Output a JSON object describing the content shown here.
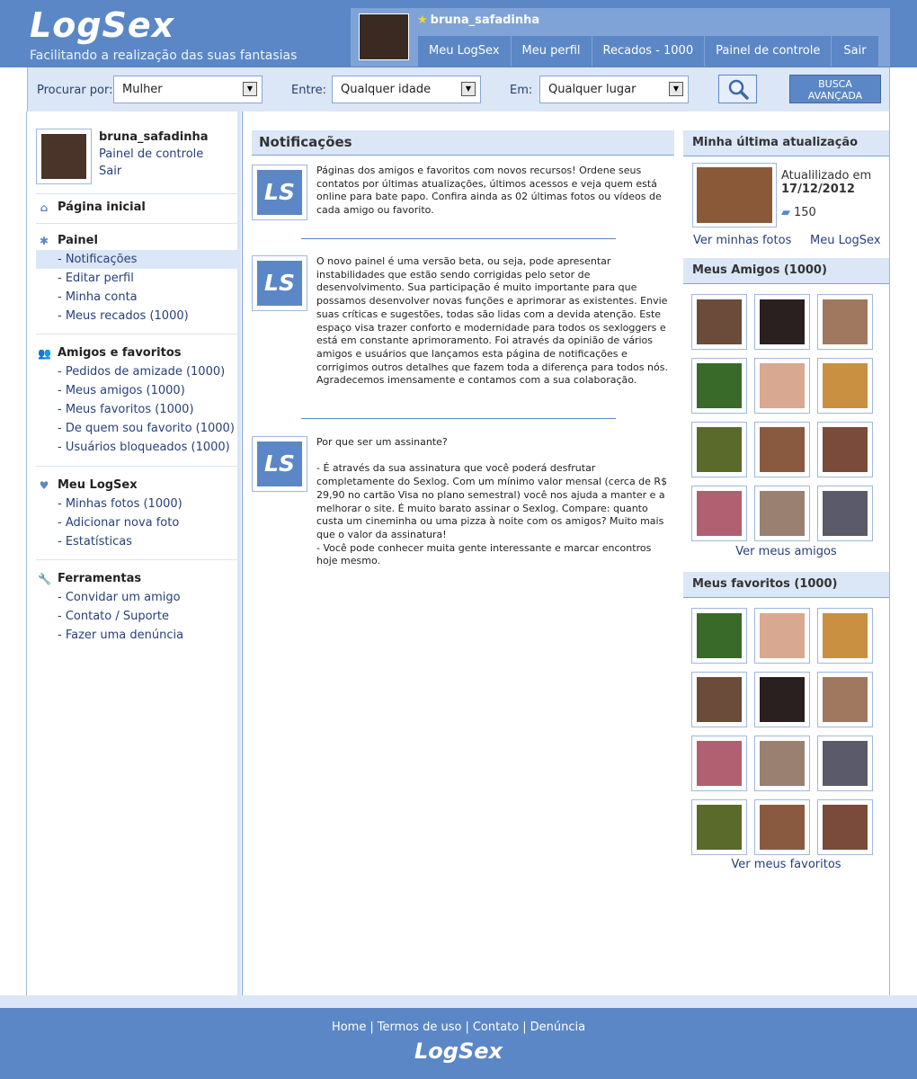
{
  "brand": {
    "logo": "LogSex",
    "tagline": "Facilitando a realização das suas fantasias"
  },
  "user": {
    "name": "bruna_safadinha"
  },
  "nav": [
    "Meu LogSex",
    "Meu perfil",
    "Recados - 1000",
    "Painel de controle",
    "Sair"
  ],
  "search": {
    "label_procurar": "Procurar por:",
    "procurar_value": "Mulher",
    "label_entre": "Entre:",
    "entre_value": "Qualquer idade",
    "label_em": "Em:",
    "em_value": "Qualquer lugar",
    "advanced_line1": "BUSCA",
    "advanced_line2": "AVANÇADA",
    "search_icon": "magnifier-icon"
  },
  "sidebar": {
    "me": {
      "name": "bruna_safadinha",
      "link1": "Painel de controle",
      "link2": "Sair"
    },
    "home": "Página inicial",
    "painel": {
      "title": "Painel",
      "items": [
        "- Notificações",
        "- Editar perfil",
        "- Minha conta",
        "- Meus recados (1000)"
      ]
    },
    "amigos": {
      "title": "Amigos e favoritos",
      "items": [
        "- Pedidos de amizade (1000)",
        "- Meus amigos (1000)",
        "- Meus favoritos (1000)",
        "- De quem sou favorito (1000)",
        "- Usuários bloqueados (1000)"
      ]
    },
    "meulogsex": {
      "title": "Meu LogSex",
      "items": [
        "- Minhas fotos (1000)",
        "- Adicionar nova foto",
        "- Estatísticas"
      ]
    },
    "ferramentas": {
      "title": "Ferramentas",
      "items": [
        "- Convidar um amigo",
        "- Contato / Suporte",
        "- Fazer uma denúncia"
      ]
    }
  },
  "main": {
    "title": "Notificações",
    "badge": "LS",
    "n1": "Páginas dos amigos e favoritos com novos recursos! Ordene seus contatos por últimas atualizações, últimos acessos e veja quem está online para bate papo. Confira ainda as 02 últimas fotos ou vídeos de cada amigo ou favorito.",
    "n2": "O novo painel é uma versão beta, ou seja, pode apresentar instabilidades que estão sendo corrigidas pelo setor de desenvolvimento. Sua participação é muito importante para que possamos desenvolver novas funções e aprimorar as existentes. Envie suas críticas e sugestões, todas são lidas com a devida atenção. Este espaço visa trazer conforto e modernidade para todos os sexloggers e está em constante aprimoramento. Foi através da opinião de vários amigos e usuários que lançamos esta página de notificações e corrigimos outros detalhes que fazem toda a diferença para todos nós. Agradecemos imensamente e contamos com a sua colaboração.",
    "n3_title": "Por que ser um assinante?",
    "n3_p1": "- É através da sua assinatura que você poderá desfrutar completamente do Sexlog. Com um mínimo valor mensal (cerca de R$ 29,90 no cartão Visa no plano semestral) você nos ajuda a manter e a melhorar o site. É muito barato assinar o Sexlog. Compare: quanto custa um cineminha ou uma pizza à noite com os amigos? Muito mais que o valor da assinatura!",
    "n3_p2": "- Você pode conhecer muita gente interessante e marcar encontros hoje mesmo."
  },
  "right": {
    "update": {
      "title": "Minha última atualização",
      "updated_label": "Atualilizado em",
      "date": "17/12/2012",
      "count": "150",
      "link_photos": "Ver minhas fotos",
      "link_meu": "Meu LogSex"
    },
    "friends": {
      "title": "Meus Amigos (1000)",
      "more": "Ver meus amigos"
    },
    "favorites": {
      "title": "Meus favoritos (1000)",
      "more": "Ver meus favoritos"
    },
    "friend_colors": [
      "#6b4b3a",
      "#2a2020",
      "#a07860",
      "#3a6a2a",
      "#d8a890",
      "#c89040",
      "#5a6a2a",
      "#8a5a40",
      "#7a4a3a",
      "#b06070",
      "#9a8070",
      "#5a5a6a"
    ],
    "fav_colors": [
      "#3a6a2a",
      "#d8a890",
      "#c89040",
      "#6b4b3a",
      "#2a2020",
      "#a07860",
      "#b06070",
      "#9a8070",
      "#5a5a6a",
      "#5a6a2a",
      "#8a5a40",
      "#7a4a3a"
    ]
  },
  "footer": {
    "links": [
      "Home",
      "Termos de uso",
      "Contato",
      "Denúncia"
    ],
    "logo": "LogSex"
  }
}
